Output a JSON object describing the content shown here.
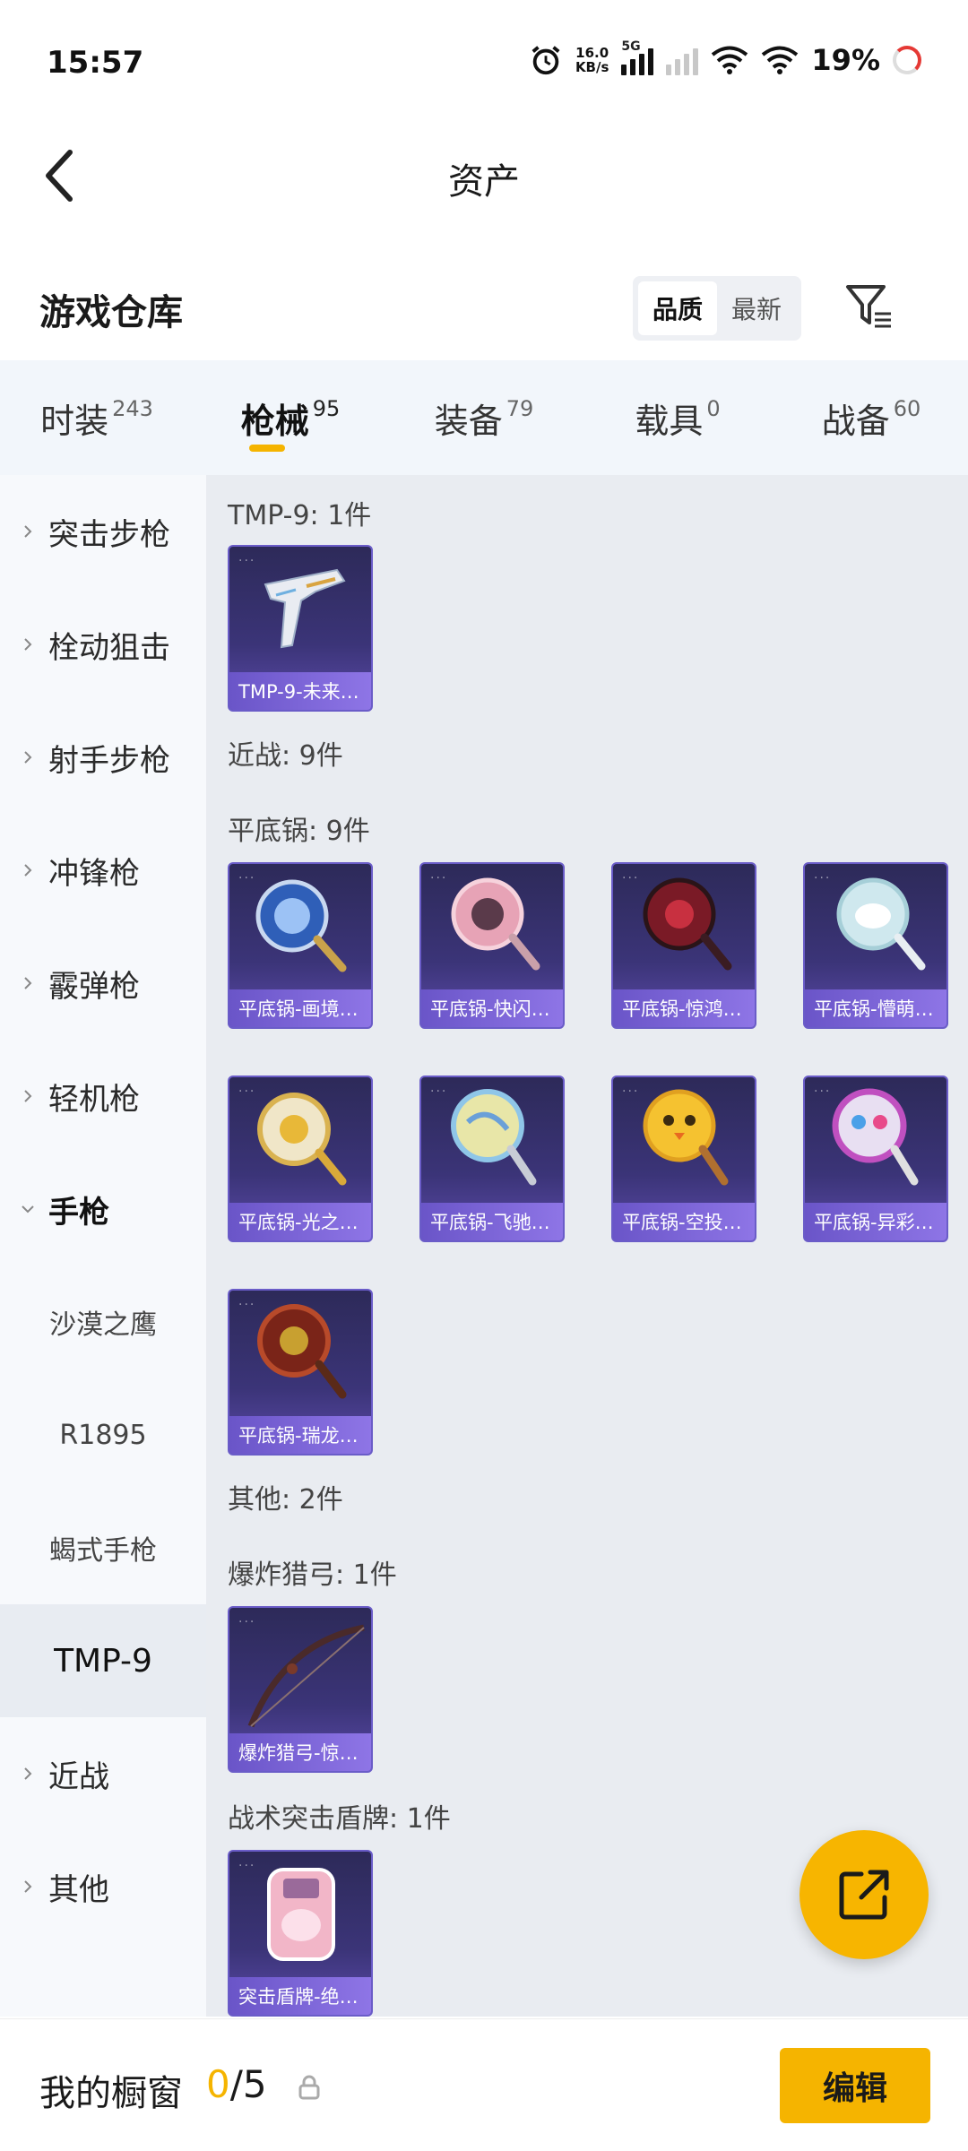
{
  "status_bar": {
    "time": "15:57",
    "net_speed_value": "16.0",
    "net_speed_unit": "KB/s",
    "network_type": "5G",
    "battery": "19%"
  },
  "header": {
    "title": "资产"
  },
  "warehouse": {
    "title": "游戏仓库",
    "sort_options": [
      "品质",
      "最新"
    ],
    "active_sort": "品质"
  },
  "categories": [
    {
      "label": "时装",
      "count": "243"
    },
    {
      "label": "枪械",
      "count": "95"
    },
    {
      "label": "装备",
      "count": "79"
    },
    {
      "label": "载具",
      "count": "0"
    },
    {
      "label": "战备",
      "count": "60"
    }
  ],
  "active_category": "枪械",
  "sidenav": {
    "items": [
      "突击步枪",
      "栓动狙击",
      "射手步枪",
      "冲锋枪",
      "霰弹枪",
      "轻机枪"
    ],
    "expanded": "手枪",
    "subitems": [
      "沙漠之鹰",
      "R1895",
      "蝎式手枪",
      "TMP-9"
    ],
    "selected_sub": "TMP-9",
    "after": [
      "近战",
      "其他"
    ]
  },
  "content": {
    "sections": {
      "tmp9": "TMP-9: 1件",
      "melee": "近战: 9件",
      "pan": "平底锅: 9件",
      "other": "其他: 2件",
      "bow": "爆炸猎弓: 1件",
      "shield": "战术突击盾牌: 1件"
    },
    "items": {
      "tmp9": "TMP-9-未来…",
      "pan1": "平底锅-画境…",
      "pan2": "平底锅-快闪…",
      "pan3": "平底锅-惊鸿…",
      "pan4": "平底锅-懵萌…",
      "pan5": "平底锅-光之…",
      "pan6": "平底锅-飞驰…",
      "pan7": "平底锅-空投…",
      "pan8": "平底锅-异彩…",
      "pan9": "平底锅-瑞龙…",
      "bow": "爆炸猎弓-惊…",
      "shield": "突击盾牌-绝…"
    }
  },
  "bottom_bar": {
    "label": "我的橱窗",
    "current": "0",
    "total": "/5",
    "edit_label": "编辑"
  },
  "colors": {
    "accent": "#f5b400",
    "item_bg": "#3b3478",
    "caption": "#7a63d8"
  },
  "icons": [
    "back-arrow-icon",
    "filter-icon",
    "share-icon",
    "lock-icon",
    "chevron-right-icon",
    "chevron-down-icon"
  ]
}
